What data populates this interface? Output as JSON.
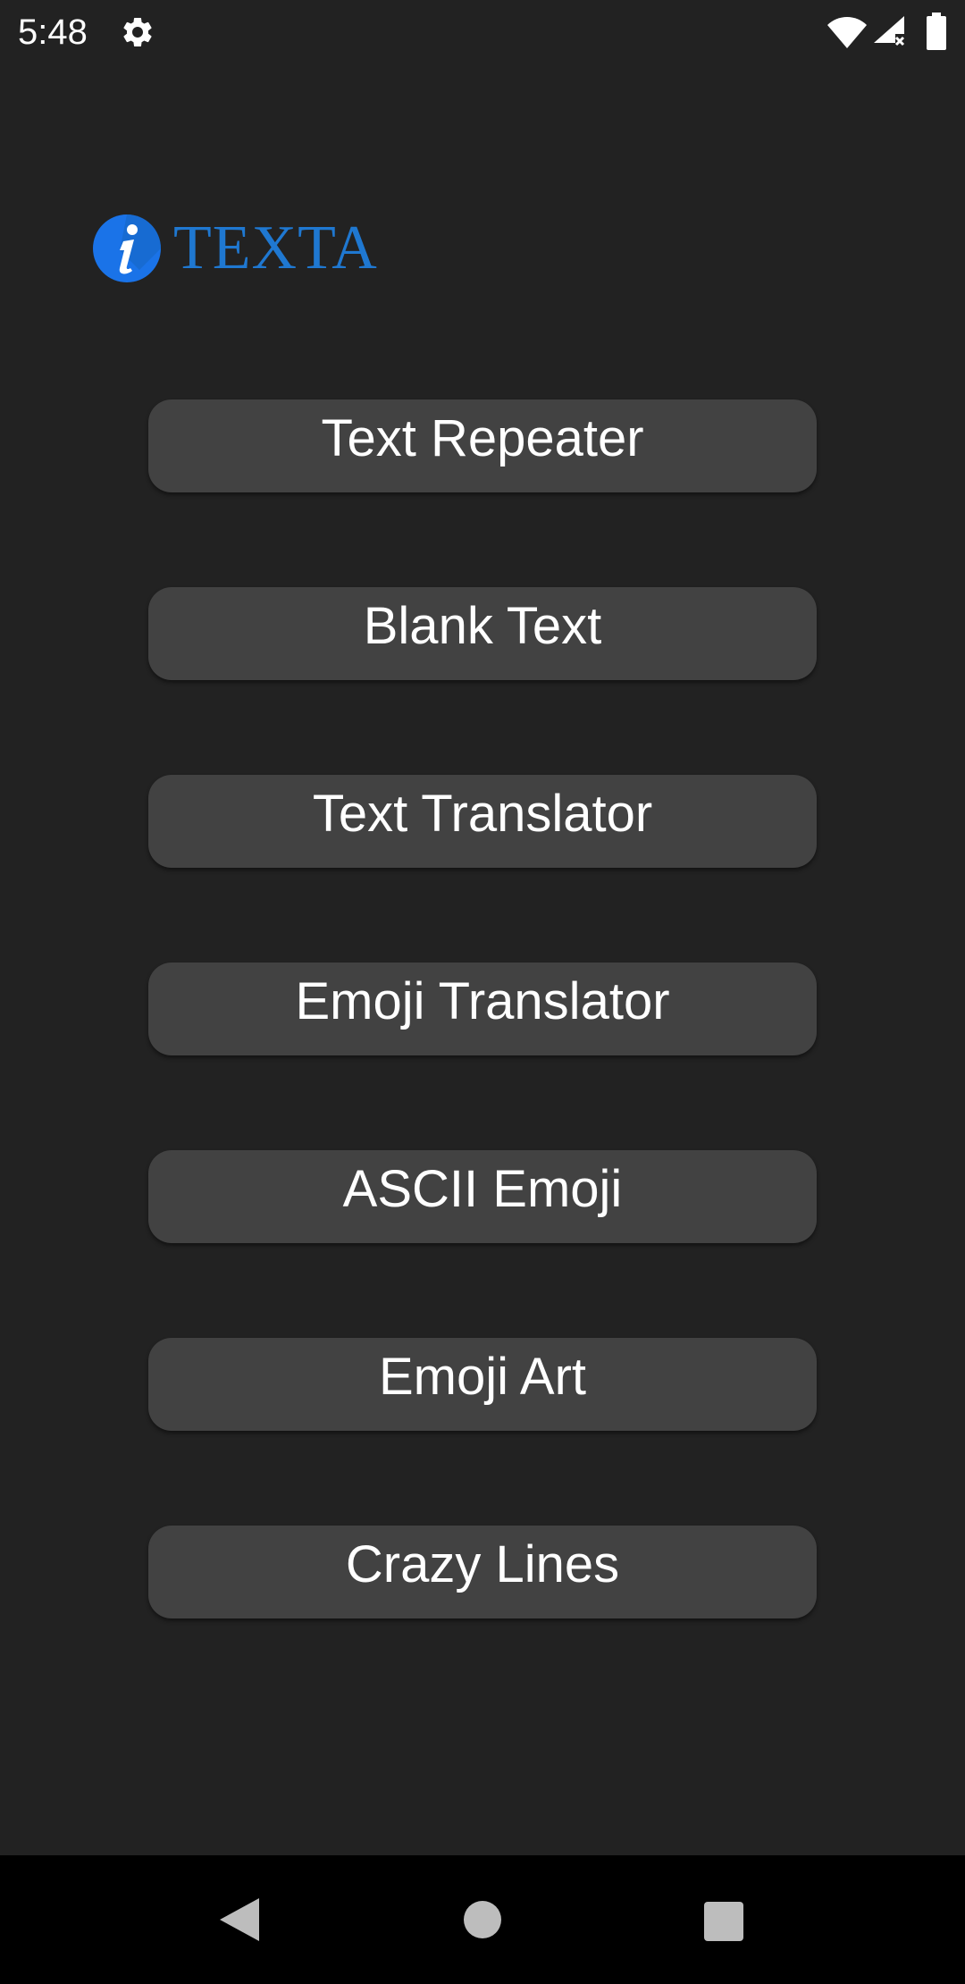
{
  "status_bar": {
    "time": "5:48",
    "icons": [
      "gear-icon",
      "wifi-icon",
      "signal-icon",
      "battery-icon"
    ]
  },
  "logo": {
    "text": "TEXTA",
    "icon": "info-icon",
    "color": "#1f78d1"
  },
  "menu": {
    "items": [
      {
        "label": "Text Repeater"
      },
      {
        "label": "Blank Text"
      },
      {
        "label": "Text Translator"
      },
      {
        "label": "Emoji Translator"
      },
      {
        "label": "ASCII Emoji"
      },
      {
        "label": "Emoji Art"
      },
      {
        "label": "Crazy Lines"
      }
    ]
  },
  "nav_bar": {
    "icons": [
      "back-icon",
      "home-icon",
      "recents-icon"
    ]
  },
  "colors": {
    "background": "#222222",
    "button": "#424242",
    "accent": "#1f78d1",
    "nav_bar": "#000000"
  }
}
